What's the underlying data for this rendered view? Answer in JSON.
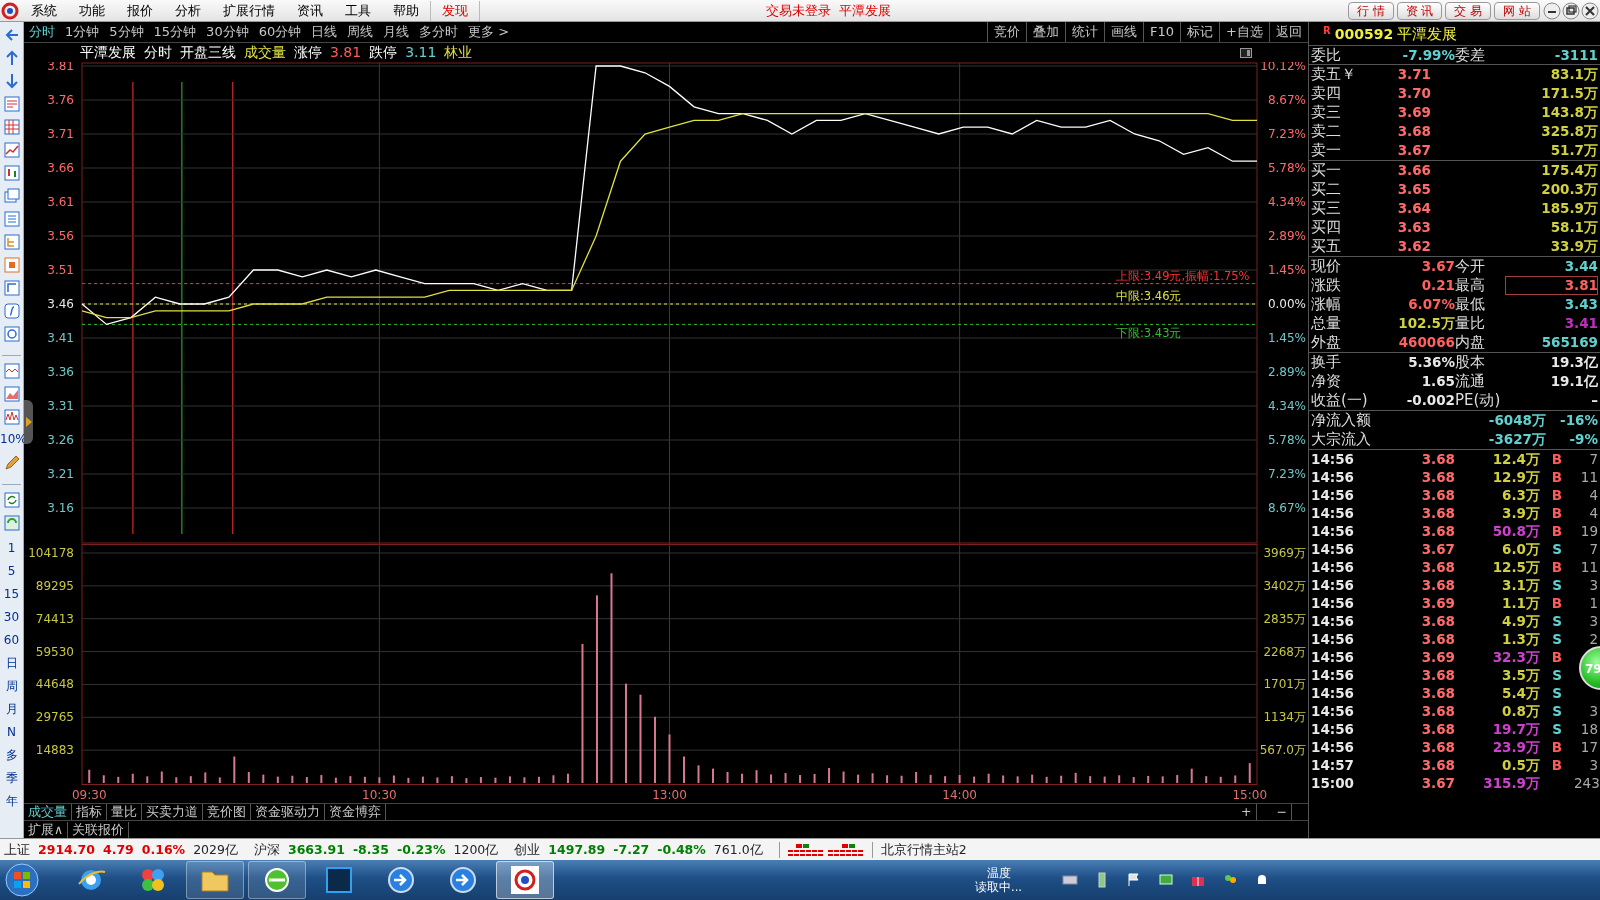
{
  "menubar": {
    "items": [
      {
        "label": "系统",
        "kind": "menu"
      },
      {
        "label": "功能",
        "kind": "menu"
      },
      {
        "label": "报价",
        "kind": "menu"
      },
      {
        "label": "分析",
        "kind": "menu"
      },
      {
        "label": "扩展行情",
        "kind": "menu"
      },
      {
        "label": "资讯",
        "kind": "menu"
      },
      {
        "label": "工具",
        "kind": "menu"
      },
      {
        "label": "帮助",
        "kind": "menu"
      },
      {
        "label": "发现",
        "kind": "highlight"
      }
    ],
    "notice": [
      "交易未登录",
      "平潭发展"
    ],
    "buttons": [
      "行 情",
      "资 讯",
      "交 易",
      "网 站"
    ]
  },
  "left_toolbar": {
    "percent_label": "10%",
    "periods": [
      "1",
      "5",
      "15",
      "30",
      "60",
      "日",
      "周",
      "月",
      "N",
      "多",
      "季",
      "年"
    ]
  },
  "period_tabs": [
    {
      "label": "分时",
      "selected": true
    },
    {
      "label": "1分钟",
      "selected": false
    },
    {
      "label": "5分钟",
      "selected": false
    },
    {
      "label": "15分钟",
      "selected": false
    },
    {
      "label": "30分钟",
      "selected": false
    },
    {
      "label": "60分钟",
      "selected": false
    },
    {
      "label": "日线",
      "selected": false
    },
    {
      "label": "周线",
      "selected": false
    },
    {
      "label": "月线",
      "selected": false
    },
    {
      "label": "多分时",
      "selected": false
    },
    {
      "label": "更多 >",
      "selected": false
    }
  ],
  "chart_tools": [
    "竞价",
    "叠加",
    "统计",
    "画线",
    "F10",
    "标记",
    "+自选",
    "返回"
  ],
  "chart_title": [
    {
      "text": "平潭发展",
      "kind": "label"
    },
    {
      "text": "分时",
      "kind": "label"
    },
    {
      "text": "开盘三线",
      "kind": "label"
    },
    {
      "text": "成交量",
      "kind": "indicator"
    },
    {
      "text": "涨停",
      "kind": "label"
    },
    {
      "text": "3.81",
      "kind": "up"
    },
    {
      "text": "跌停",
      "kind": "label"
    },
    {
      "text": "3.11",
      "kind": "down"
    },
    {
      "text": "林业",
      "kind": "indicator"
    }
  ],
  "price_chart": {
    "chart_data": {
      "type": "line",
      "series": [
        {
          "color": "#ffffff",
          "values": [
            3.46,
            3.43,
            3.44,
            3.47,
            3.46,
            3.46,
            3.47,
            3.51,
            3.51,
            3.5,
            3.51,
            3.5,
            3.51,
            3.5,
            3.49,
            3.49,
            3.49,
            3.48,
            3.49,
            3.48,
            3.48,
            3.81,
            3.81,
            3.8,
            3.78,
            3.75,
            3.74,
            3.74,
            3.73,
            3.71,
            3.73,
            3.73,
            3.74,
            3.73,
            3.72,
            3.71,
            3.72,
            3.72,
            3.71,
            3.73,
            3.72,
            3.72,
            3.73,
            3.71,
            3.7,
            3.68,
            3.69,
            3.67,
            3.67
          ]
        },
        {
          "color": "#e0e040",
          "values": [
            3.45,
            3.44,
            3.44,
            3.45,
            3.45,
            3.45,
            3.45,
            3.46,
            3.46,
            3.46,
            3.47,
            3.47,
            3.47,
            3.47,
            3.47,
            3.48,
            3.48,
            3.48,
            3.48,
            3.48,
            3.48,
            3.56,
            3.67,
            3.71,
            3.72,
            3.73,
            3.73,
            3.74,
            3.74,
            3.74,
            3.74,
            3.74,
            3.74,
            3.74,
            3.74,
            3.74,
            3.74,
            3.74,
            3.74,
            3.74,
            3.74,
            3.74,
            3.74,
            3.74,
            3.74,
            3.74,
            3.74,
            3.73,
            3.73
          ]
        }
      ],
      "ylim": [
        3.11,
        3.81
      ],
      "yticks": [
        3.81,
        3.76,
        3.71,
        3.66,
        3.61,
        3.56,
        3.51,
        3.46,
        3.41,
        3.36,
        3.31,
        3.26,
        3.21,
        3.16
      ],
      "grid": true,
      "ref_lines": [
        {
          "axis": "y",
          "value": 3.49,
          "label": "上限:3.49元,振幅:1.75%",
          "color": "#ff3030"
        },
        {
          "axis": "y",
          "value": 3.46,
          "label": "中限:3.46元",
          "color": "#e0e040"
        },
        {
          "axis": "y",
          "value": 3.43,
          "label": "下限:3.43元",
          "color": "#30c030"
        }
      ]
    },
    "right_labels": [
      "10.12%",
      "8.67%",
      "7.23%",
      "5.78%",
      "4.34%",
      "2.89%",
      "1.45%",
      "0.00%",
      "1.45%",
      "2.89%",
      "4.34%",
      "5.78%",
      "7.23%",
      "8.67%"
    ]
  },
  "volume_chart": {
    "chart_data": {
      "type": "bar",
      "categories": [
        "09:30",
        null,
        null,
        null,
        null,
        null,
        null,
        null,
        null,
        null,
        null,
        null,
        null,
        null,
        null,
        null,
        null,
        null,
        null,
        null,
        "10:30",
        null,
        null,
        null,
        null,
        null,
        null,
        null,
        null,
        null,
        null,
        null,
        null,
        null,
        null,
        null,
        null,
        null,
        null,
        null,
        "13:00",
        null,
        null,
        null,
        null,
        null,
        null,
        null,
        null,
        null,
        null,
        null,
        null,
        null,
        null,
        null,
        null,
        null,
        null,
        null,
        "14:00",
        null,
        null,
        null,
        null,
        null,
        null,
        null,
        null,
        null,
        null,
        null,
        null,
        null,
        null,
        null,
        null,
        null,
        null,
        null,
        "15:00"
      ],
      "series": [
        {
          "color": "#d87890",
          "values": [
            6000,
            3500,
            2800,
            4200,
            3000,
            5200,
            2600,
            3100,
            4800,
            2500,
            12000,
            5000,
            3800,
            2900,
            3300,
            2700,
            3600,
            2400,
            3100,
            2800,
            2600,
            3400,
            2300,
            2900,
            2500,
            3100,
            2200,
            2700,
            2400,
            3000,
            2600,
            2800,
            3500,
            4200,
            63000,
            85000,
            95000,
            45000,
            40000,
            30000,
            22000,
            12000,
            8000,
            6500,
            5000,
            4200,
            5800,
            3900,
            4500,
            3600,
            4100,
            6800,
            5200,
            3800,
            4400,
            3500,
            3300,
            5000,
            3700,
            3100,
            3600,
            2900,
            4200,
            3400,
            3000,
            3800,
            2800,
            3300,
            4600,
            3100,
            2900,
            3500,
            2700,
            3200,
            3000,
            3600,
            6500,
            3100,
            2800,
            3400,
            9000
          ]
        }
      ],
      "ylim": [
        0,
        104178
      ],
      "grid": true,
      "yticks": [
        104178,
        89295,
        74413,
        59530,
        44648,
        29765,
        14883
      ]
    },
    "right_labels": [
      "3969万",
      "3402万",
      "2835万",
      "2268万",
      "1701万",
      "1134万",
      "567.0万"
    ]
  },
  "indicator_tabs": [
    {
      "label": "成交量",
      "selected": true
    },
    {
      "label": "指标",
      "selected": false
    },
    {
      "label": "量比",
      "selected": false
    },
    {
      "label": "买卖力道",
      "selected": false
    },
    {
      "label": "竞价图",
      "selected": false
    },
    {
      "label": "资金驱动力",
      "selected": false
    },
    {
      "label": "资金博弈",
      "selected": false
    }
  ],
  "zoom_buttons": [
    "+",
    "−"
  ],
  "extra_tabs": [
    "扩展∧",
    "关联报价"
  ],
  "quote": {
    "badge": "R",
    "code": "000592",
    "name": "平潭发展",
    "ratio": [
      {
        "label": "委比",
        "value": "-7.99%"
      },
      {
        "label": "委差",
        "value": "-3111"
      }
    ],
    "sells": [
      {
        "label": "卖五￥",
        "price": "3.71",
        "volume": "83.1万"
      },
      {
        "label": "卖四",
        "price": "3.70",
        "volume": "171.5万"
      },
      {
        "label": "卖三",
        "price": "3.69",
        "volume": "143.8万"
      },
      {
        "label": "卖二",
        "price": "3.68",
        "volume": "325.8万"
      },
      {
        "label": "卖一",
        "price": "3.67",
        "volume": "51.7万"
      }
    ],
    "buys": [
      {
        "label": "买一",
        "price": "3.66",
        "volume": "175.4万"
      },
      {
        "label": "买二",
        "price": "3.65",
        "volume": "200.3万"
      },
      {
        "label": "买三",
        "price": "3.64",
        "volume": "185.9万"
      },
      {
        "label": "买四",
        "price": "3.63",
        "volume": "58.1万"
      },
      {
        "label": "买五",
        "price": "3.62",
        "volume": "33.9万"
      }
    ],
    "stats": [
      {
        "label": "现价",
        "value": "3.67",
        "color": "#ff6060",
        "boxed": false
      },
      {
        "label": "今开",
        "value": "3.44",
        "color": "#60d0d0",
        "boxed": false
      },
      {
        "label": "涨跌",
        "value": "0.21",
        "color": "#ff6060",
        "boxed": false
      },
      {
        "label": "最高",
        "value": "3.81",
        "color": "#ff6060",
        "boxed": true
      },
      {
        "label": "涨幅",
        "value": "6.07%",
        "color": "#ff6060",
        "boxed": false
      },
      {
        "label": "最低",
        "value": "3.43",
        "color": "#60d0d0",
        "boxed": false
      },
      {
        "label": "总量",
        "value": "102.5万",
        "color": "#d0d040",
        "boxed": false
      },
      {
        "label": "量比",
        "value": "3.41",
        "color": "#c030c0",
        "boxed": false
      },
      {
        "label": "外盘",
        "value": "460066",
        "color": "#ff6060",
        "boxed": false
      },
      {
        "label": "内盘",
        "value": "565169",
        "color": "#60d0d0",
        "boxed": false
      }
    ],
    "fundamentals": [
      {
        "label": "换手",
        "value": "5.36%"
      },
      {
        "label": "股本",
        "value": "19.3亿"
      },
      {
        "label": "净资",
        "value": "1.65"
      },
      {
        "label": "流通",
        "value": "19.1亿"
      },
      {
        "label": "收益(一)",
        "value": "-0.002"
      },
      {
        "label": "PE(动)",
        "value": "–"
      }
    ],
    "flows": [
      {
        "label": "净流入额",
        "amount": "-6048万",
        "pct": "-16%"
      },
      {
        "label": "大宗流入",
        "amount": "-3627万",
        "pct": "-9%"
      }
    ]
  },
  "trades": [
    {
      "time": "14:56",
      "price": "3.68",
      "volume": "12.4万",
      "large": false,
      "side": "B",
      "kind": "buy",
      "count": "7"
    },
    {
      "time": "14:56",
      "price": "3.68",
      "volume": "12.9万",
      "large": false,
      "side": "B",
      "kind": "buy",
      "count": "11"
    },
    {
      "time": "14:56",
      "price": "3.68",
      "volume": "6.3万",
      "large": false,
      "side": "B",
      "kind": "buy",
      "count": "4"
    },
    {
      "time": "14:56",
      "price": "3.68",
      "volume": "3.9万",
      "large": false,
      "side": "B",
      "kind": "buy",
      "count": "4"
    },
    {
      "time": "14:56",
      "price": "3.68",
      "volume": "50.8万",
      "large": true,
      "side": "B",
      "kind": "buy",
      "count": "19"
    },
    {
      "time": "14:56",
      "price": "3.67",
      "volume": "6.0万",
      "large": false,
      "side": "S",
      "kind": "sell",
      "count": "7"
    },
    {
      "time": "14:56",
      "price": "3.68",
      "volume": "12.5万",
      "large": false,
      "side": "B",
      "kind": "buy",
      "count": "11"
    },
    {
      "time": "14:56",
      "price": "3.68",
      "volume": "3.1万",
      "large": false,
      "side": "S",
      "kind": "sell",
      "count": "3"
    },
    {
      "time": "14:56",
      "price": "3.69",
      "volume": "1.1万",
      "large": false,
      "side": "B",
      "kind": "buy",
      "count": "1"
    },
    {
      "time": "14:56",
      "price": "3.68",
      "volume": "4.9万",
      "large": false,
      "side": "S",
      "kind": "sell",
      "count": "3"
    },
    {
      "time": "14:56",
      "price": "3.68",
      "volume": "1.3万",
      "large": false,
      "side": "S",
      "kind": "sell",
      "count": "2"
    },
    {
      "time": "14:56",
      "price": "3.69",
      "volume": "32.3万",
      "large": true,
      "side": "B",
      "kind": "buy"
    },
    {
      "time": "14:56",
      "price": "3.68",
      "volume": "3.5万",
      "large": false,
      "side": "S",
      "kind": "sell"
    },
    {
      "time": "14:56",
      "price": "3.68",
      "volume": "5.4万",
      "large": false,
      "side": "S",
      "kind": "sell"
    },
    {
      "time": "14:56",
      "price": "3.68",
      "volume": "0.8万",
      "large": false,
      "side": "S",
      "kind": "sell",
      "count": "3"
    },
    {
      "time": "14:56",
      "price": "3.68",
      "volume": "19.7万",
      "large": true,
      "side": "S",
      "kind": "sell",
      "count": "18"
    },
    {
      "time": "14:56",
      "price": "3.68",
      "volume": "23.9万",
      "large": true,
      "side": "B",
      "kind": "buy",
      "count": "17"
    },
    {
      "time": "14:57",
      "price": "3.68",
      "volume": "0.5万",
      "large": false,
      "side": "B",
      "kind": "buy",
      "count": "3"
    },
    {
      "time": "15:00",
      "price": "3.67",
      "volume": "315.9万",
      "large": true,
      "kind": "none",
      "count": "243"
    }
  ],
  "speed_ball": {
    "text": "79"
  },
  "status_bar": {
    "indices": [
      {
        "name": "上证",
        "value": "2914.70",
        "change": "4.79",
        "pct": "0.16%",
        "amount": "2029亿",
        "color": "#e00000"
      },
      {
        "name": "沪深",
        "value": "3663.91",
        "change": "-8.35",
        "pct": "-0.23%",
        "amount": "1200亿",
        "color": "#008000"
      },
      {
        "name": "创业",
        "value": "1497.89",
        "change": "-7.27",
        "pct": "-0.48%",
        "amount": "761.0亿",
        "color": "#008000"
      }
    ],
    "server": "北京行情主站2"
  },
  "taskbar": {
    "apps": [
      {
        "kind": "browser",
        "selected": false
      },
      {
        "kind": "balls",
        "selected": false
      },
      {
        "kind": "folder",
        "selected": false
      },
      {
        "kind": "green",
        "selected": false
      },
      {
        "kind": "photo",
        "selected": false
      },
      {
        "kind": "arrow",
        "selected": false
      },
      {
        "kind": "arrow",
        "selected": false
      },
      {
        "kind": "app",
        "selected": true
      }
    ],
    "weather": [
      "温度",
      "读取中..."
    ]
  }
}
